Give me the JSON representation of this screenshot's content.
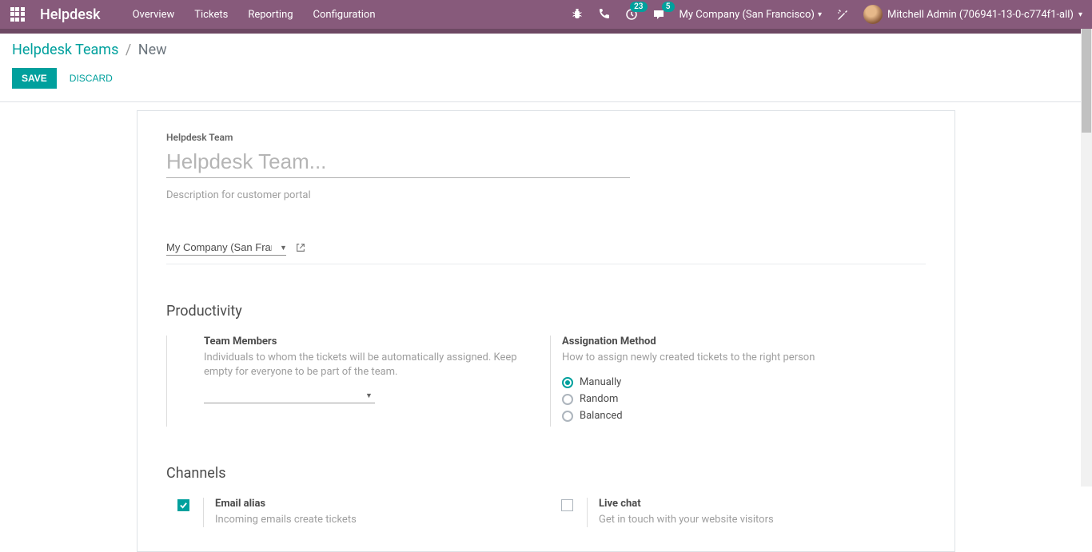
{
  "navbar": {
    "brand": "Helpdesk",
    "menu": [
      "Overview",
      "Tickets",
      "Reporting",
      "Configuration"
    ],
    "activities_count": "23",
    "messages_count": "5",
    "company": "My Company (San Francisco)",
    "user": "Mitchell Admin (706941-13-0-c774f1-all)"
  },
  "breadcrumb": {
    "parent": "Helpdesk Teams",
    "current": "New"
  },
  "actions": {
    "save": "SAVE",
    "discard": "DISCARD"
  },
  "form": {
    "label_team": "Helpdesk Team",
    "placeholder_team": "Helpdesk Team...",
    "desc_placeholder": "Description for customer portal",
    "company_value": "My Company (San Francis",
    "sections": {
      "productivity": {
        "title": "Productivity",
        "team_members": {
          "title": "Team Members",
          "desc": "Individuals to whom the tickets will be automatically assigned. Keep empty for everyone to be part of the team."
        },
        "assignation": {
          "title": "Assignation Method",
          "desc": "How to assign newly created tickets to the right person",
          "options": [
            "Manually",
            "Random",
            "Balanced"
          ],
          "selected": "Manually"
        }
      },
      "channels": {
        "title": "Channels",
        "email": {
          "title": "Email alias",
          "desc": "Incoming emails create tickets",
          "checked": true
        },
        "livechat": {
          "title": "Live chat",
          "desc": "Get in touch with your website visitors",
          "checked": false
        }
      }
    }
  }
}
